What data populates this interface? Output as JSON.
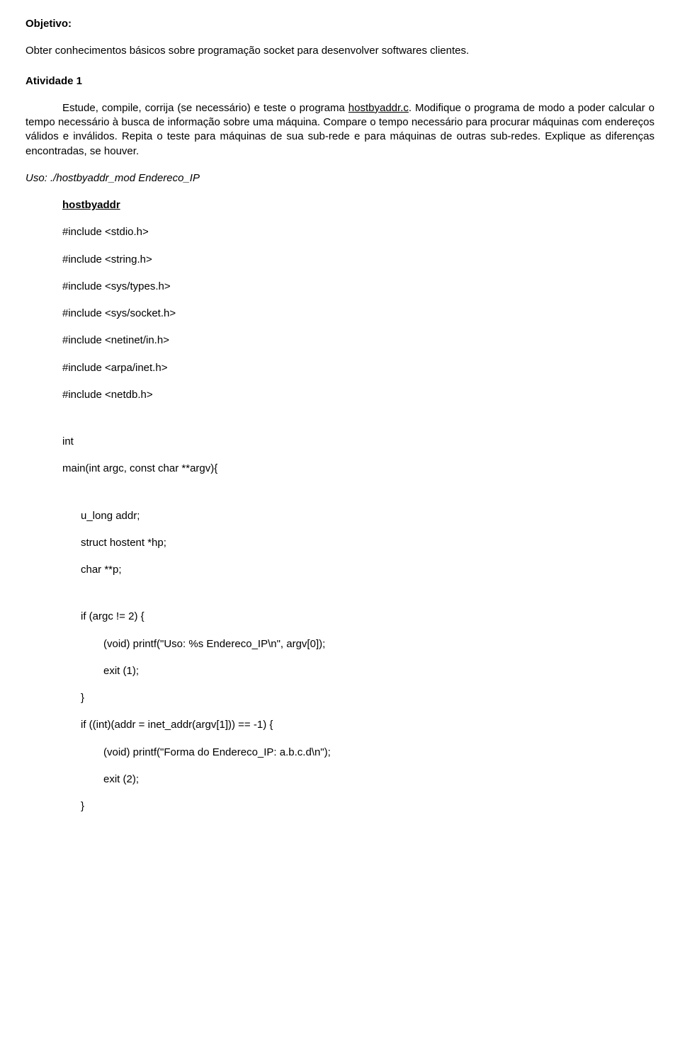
{
  "heading_objective": "Objetivo:",
  "objective_text": "Obter conhecimentos básicos sobre programação socket para desenvolver softwares clientes.",
  "activity_title": "Atividade 1",
  "activity_intro_pre": "Estude, compile, corrija (se necessário) e teste o programa ",
  "activity_link": "hostbyaddr.c",
  "activity_intro_post": ". Modifique o programa de modo a poder calcular o tempo necessário à busca de informação sobre uma máquina. Compare o tempo necessário para procurar máquinas com endereços válidos e inválidos. Repita o teste para máquinas de sua sub-rede e para máquinas de outras sub-redes. Explique as diferenças encontradas, se houver.",
  "uso_label": "Uso: ",
  "uso_value": "./hostbyaddr_mod Endereco_IP",
  "hostbyaddr_link": "hostbyaddr",
  "includes": [
    "#include <stdio.h>",
    "#include <string.h>",
    "#include <sys/types.h>",
    "#include <sys/socket.h>",
    "#include <netinet/in.h>",
    "#include <arpa/inet.h>",
    "#include <netdb.h>"
  ],
  "code_int": "int",
  "code_main_decl": "main(int argc, const char **argv){",
  "code_u_long": "u_long addr;",
  "code_struct": "struct hostent *hp;",
  "code_charpp": "char **p;",
  "code_if_argc": "if (argc != 2) {",
  "code_printf_uso": "(void) printf(\"Uso: %s Endereco_IP\\n\", argv[0]);",
  "code_exit1": "exit (1);",
  "code_close_brace": "}",
  "code_if_addr": "if ((int)(addr = inet_addr(argv[1])) == -1) {",
  "code_printf_forma": "(void) printf(\"Forma do Endereco_IP: a.b.c.d\\n\");",
  "code_exit2": "exit (2);",
  "code_close_brace2": "}"
}
